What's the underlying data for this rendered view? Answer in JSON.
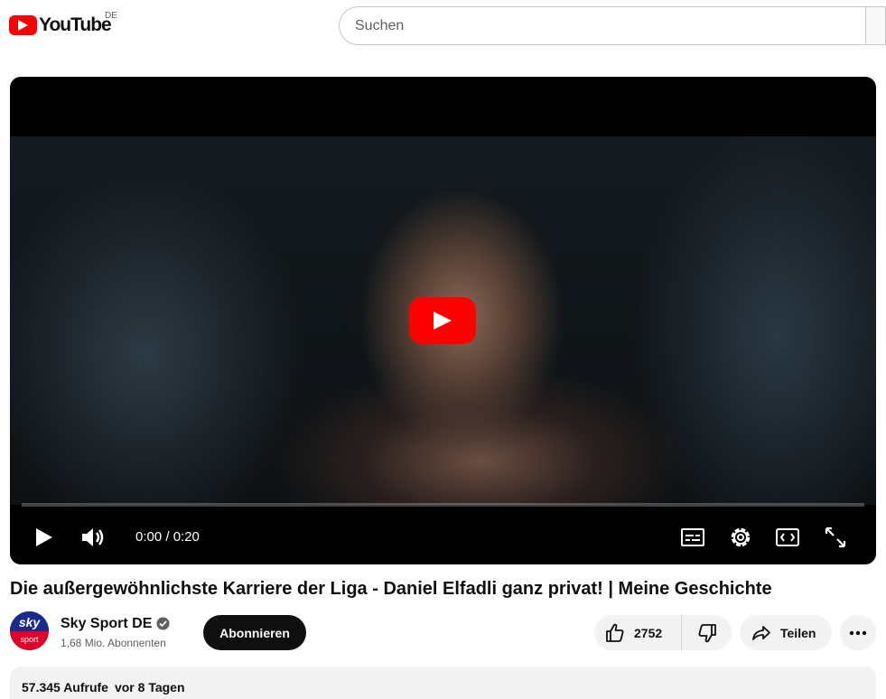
{
  "header": {
    "logo_text": "YouTube",
    "region": "DE",
    "search_placeholder": "Suchen"
  },
  "player": {
    "time_current": "0:00",
    "time_total": "0:20",
    "time_display": "0:00 / 0:20",
    "progress": 0,
    "icons": [
      "play-icon",
      "volume-icon",
      "subtitles-icon",
      "settings-icon",
      "theater-mode-icon",
      "fullscreen-icon"
    ]
  },
  "video": {
    "title": "Die außergewöhnlichste Karriere der Liga - Daniel Elfadli ganz privat! | Meine Geschichte"
  },
  "channel": {
    "name": "Sky Sport DE",
    "avatar_top": "sky",
    "avatar_bottom": "sport",
    "subscribers": "1,68 Mio. Abonnenten",
    "subscribe_label": "Abonnieren"
  },
  "actions": {
    "like_count": "2752",
    "share_label": "Teilen"
  },
  "description": {
    "views": "57.345 Aufrufe",
    "date": "vor 8 Tagen"
  },
  "colors": {
    "brand_red": "#ff0000",
    "subscribe_bg": "#0f0f0f",
    "pill_bg": "#f2f2f2"
  }
}
